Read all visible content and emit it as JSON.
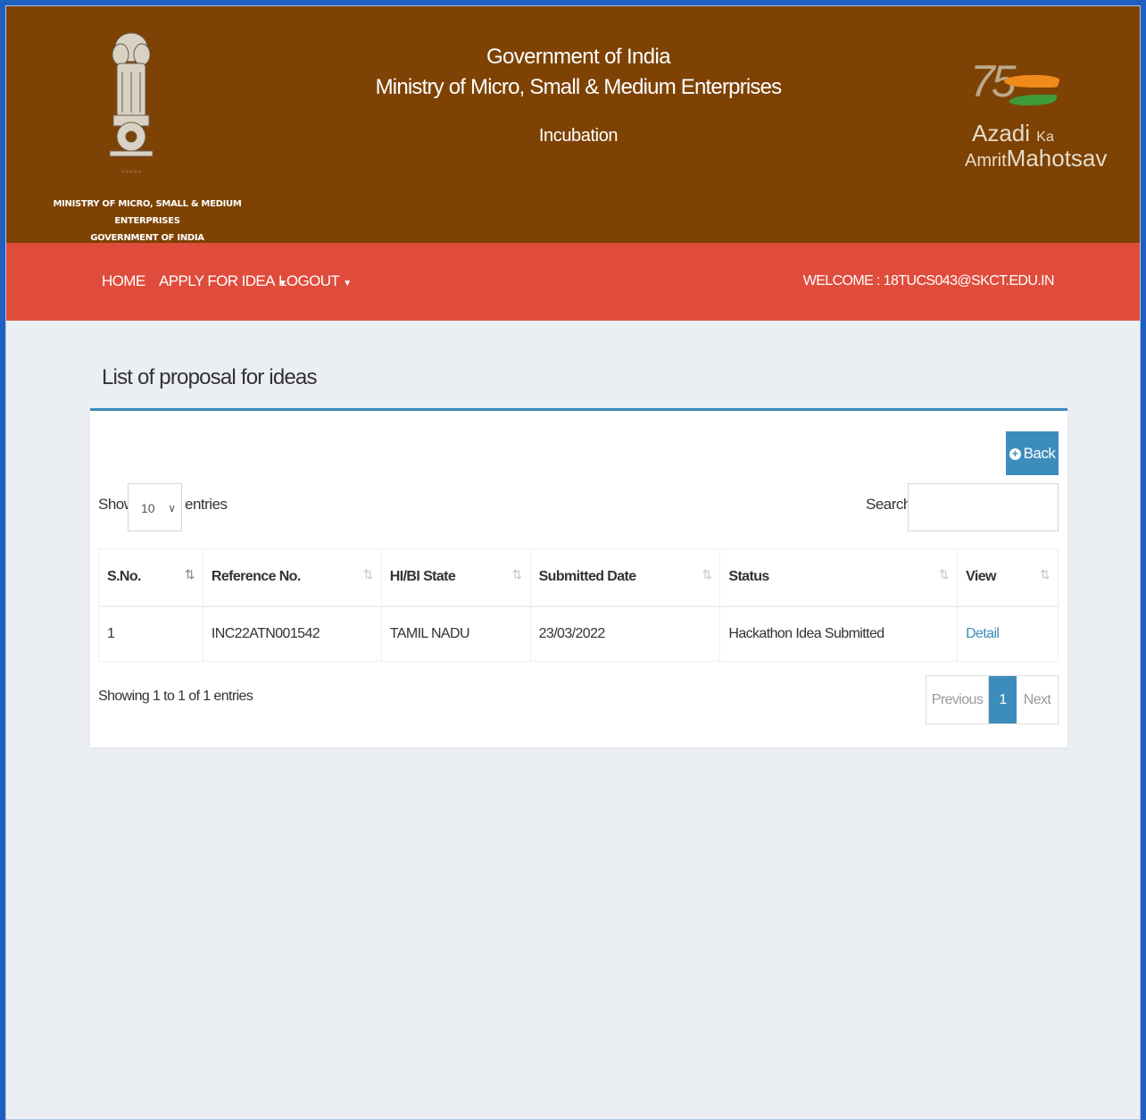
{
  "header": {
    "title_line1": "Government of India",
    "title_line2": "Ministry of Micro, Small & Medium Enterprises",
    "subtitle": "Incubation",
    "emblem_caption_line1": "MINISTRY OF MICRO, SMALL & MEDIUM ENTERPRISES",
    "emblem_caption_line2": "GOVERNMENT OF INDIA",
    "azadi_number": "75",
    "azadi_line1": "Azadi",
    "azadi_line1_suffix": "Ka",
    "azadi_line2": "Amrit",
    "azadi_line2_suffix": "Mahotsav"
  },
  "nav": {
    "home": "HOME",
    "apply": "APPLY FOR IDEA",
    "logout": "LOGOUT",
    "welcome": "WELCOME : 18TUCS043@SKCT.EDU.IN"
  },
  "page": {
    "title": "List of proposal for ideas",
    "back_label": "Back",
    "show_label": "Show",
    "entries_value": "10",
    "entries_label": "entries",
    "search_label": "Search:",
    "search_value": ""
  },
  "table": {
    "columns": [
      "S.No.",
      "Reference No.",
      "HI/BI State",
      "Submitted Date",
      "Status",
      "View"
    ],
    "rows": [
      {
        "sno": "1",
        "reference": "INC22ATN001542",
        "state": "TAMIL NADU",
        "date": "23/03/2022",
        "status": "Hackathon Idea Submitted",
        "view": "Detail"
      }
    ]
  },
  "footer": {
    "info": "Showing 1 to 1 of 1 entries",
    "prev": "Previous",
    "current": "1",
    "next": "Next"
  },
  "colors": {
    "header_bg": "#7d4204",
    "nav_bg": "#e04c3c",
    "accent": "#3c8dbc",
    "page_bg": "#ebeef3",
    "outer_frame": "#1f5fbf"
  },
  "icons": {
    "emblem": "national-emblem-icon",
    "back": "plus-circle-icon",
    "sort": "sort-icon",
    "caret": "caret-down-icon"
  }
}
